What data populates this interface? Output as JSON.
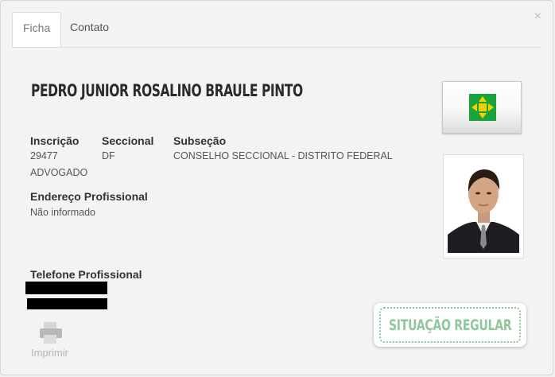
{
  "tabs": [
    {
      "label": "Ficha",
      "active": true
    },
    {
      "label": "Contato",
      "active": false
    }
  ],
  "close_symbol": "×",
  "profile": {
    "name": "PEDRO JUNIOR ROSALINO BRAULE PINTO",
    "inscricao_label": "Inscrição",
    "inscricao_value": "29477",
    "tipo": "ADVOGADO",
    "seccional_label": "Seccional",
    "seccional_value": "DF",
    "subsecao_label": "Subseção",
    "subsecao_value": "CONSELHO SECCIONAL - DISTRITO FEDERAL",
    "endereco_label": "Endereço Profissional",
    "endereco_value": "Não informado",
    "telefone_label": "Telefone Profissional"
  },
  "print_label": "Imprimir",
  "status_label": "SITUAÇÃO REGULAR",
  "colors": {
    "flag_green": "#19a33a",
    "flag_yellow": "#f5d000",
    "status_green": "#8ec79b"
  },
  "icons": [
    "close-icon",
    "df-flag-icon",
    "printer-icon"
  ]
}
